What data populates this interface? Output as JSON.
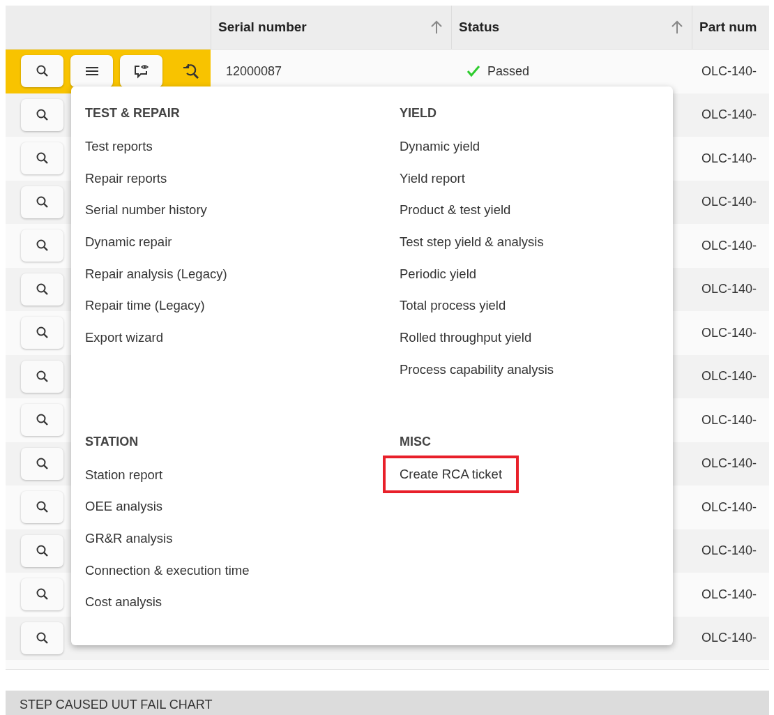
{
  "table": {
    "columns": [
      {
        "label": "Serial number",
        "sortable": true
      },
      {
        "label": "Status",
        "sortable": true
      },
      {
        "label": "Part num",
        "sortable": false
      }
    ],
    "rows": [
      {
        "selected": true,
        "serial_number": "12000087",
        "status": "Passed",
        "part_number": "OLC-140-"
      },
      {
        "selected": false,
        "part_number": "OLC-140-"
      },
      {
        "selected": false,
        "part_number": "OLC-140-"
      },
      {
        "selected": false,
        "part_number": "OLC-140-"
      },
      {
        "selected": false,
        "part_number": "OLC-140-"
      },
      {
        "selected": false,
        "part_number": "OLC-140-"
      },
      {
        "selected": false,
        "part_number": "OLC-140-"
      },
      {
        "selected": false,
        "part_number": "OLC-140-"
      },
      {
        "selected": false,
        "part_number": "OLC-140-"
      },
      {
        "selected": false,
        "part_number": "OLC-140-"
      },
      {
        "selected": false,
        "part_number": "OLC-140-"
      },
      {
        "selected": false,
        "part_number": "OLC-140-"
      },
      {
        "selected": false,
        "part_number": "OLC-140-"
      },
      {
        "selected": false,
        "part_number": "OLC-140-"
      }
    ]
  },
  "context_menu": {
    "sections": [
      {
        "heading": "TEST & REPAIR",
        "items": [
          {
            "label": "Test reports",
            "highlighted": false
          },
          {
            "label": "Repair reports",
            "highlighted": false
          },
          {
            "label": "Serial number history",
            "highlighted": false
          },
          {
            "label": "Dynamic repair",
            "highlighted": false
          },
          {
            "label": "Repair analysis (Legacy)",
            "highlighted": false
          },
          {
            "label": "Repair time (Legacy)",
            "highlighted": false
          },
          {
            "label": "Export wizard",
            "highlighted": false
          }
        ]
      },
      {
        "heading": "YIELD",
        "items": [
          {
            "label": "Dynamic yield",
            "highlighted": false
          },
          {
            "label": "Yield report",
            "highlighted": false
          },
          {
            "label": "Product & test yield",
            "highlighted": false
          },
          {
            "label": "Test step yield & analysis",
            "highlighted": false
          },
          {
            "label": "Periodic yield",
            "highlighted": false
          },
          {
            "label": "Total process yield",
            "highlighted": false
          },
          {
            "label": "Rolled throughput yield",
            "highlighted": false
          },
          {
            "label": "Process capability analysis",
            "highlighted": false
          }
        ]
      },
      {
        "heading": "STATION",
        "items": [
          {
            "label": "Station report",
            "highlighted": false
          },
          {
            "label": "OEE analysis",
            "highlighted": false
          },
          {
            "label": "GR&R analysis",
            "highlighted": false
          },
          {
            "label": "Connection & execution time",
            "highlighted": false
          },
          {
            "label": "Cost analysis",
            "highlighted": false
          }
        ]
      },
      {
        "heading": "MISC",
        "items": [
          {
            "label": "Create RCA ticket",
            "highlighted": true
          }
        ]
      }
    ]
  },
  "section": {
    "title": "STEP CAUSED UUT FAIL CHART"
  }
}
